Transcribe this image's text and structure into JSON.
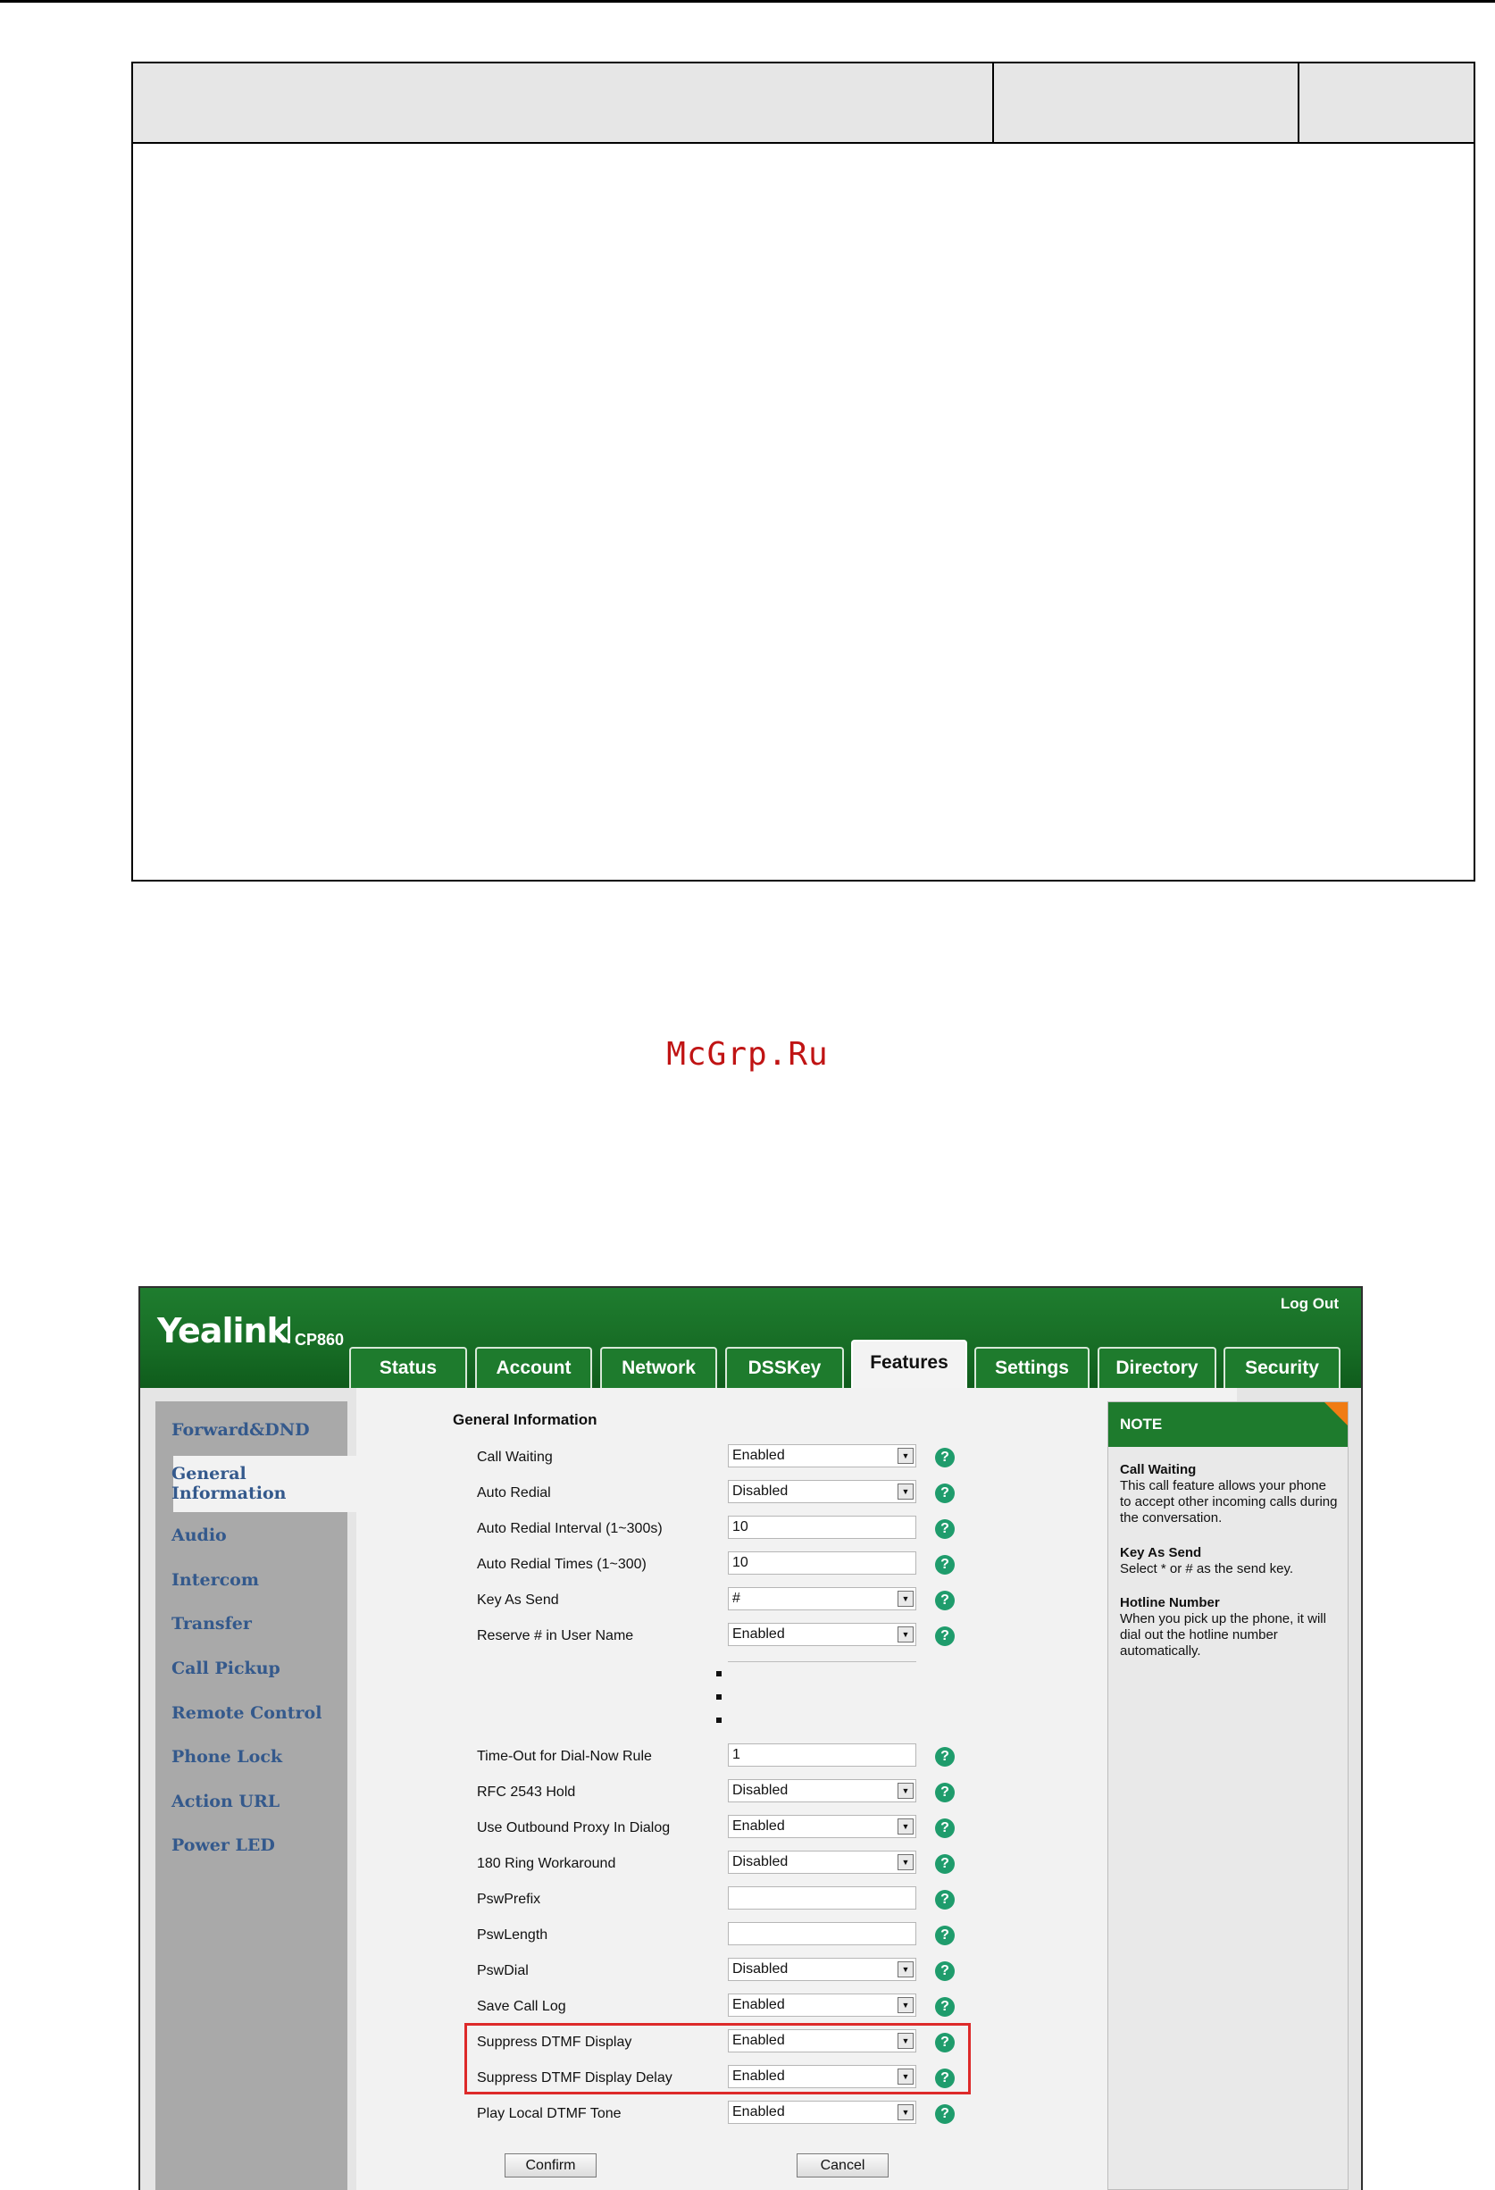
{
  "watermark": "McGrp.Ru",
  "brand": {
    "logo": "Yealink",
    "model": "CP860",
    "logout": "Log Out"
  },
  "tabs": [
    "Status",
    "Account",
    "Network",
    "DSSKey",
    "Features",
    "Settings",
    "Directory",
    "Security"
  ],
  "active_tab": "Features",
  "sidebar": {
    "items": [
      "Forward&DND",
      "General Information",
      "Audio",
      "Intercom",
      "Transfer",
      "Call Pickup",
      "Remote Control",
      "Phone Lock",
      "Action URL",
      "Power LED"
    ],
    "active": "General Information"
  },
  "form": {
    "title": "General Information",
    "rows": [
      {
        "label": "Call Waiting",
        "value": "Enabled",
        "type": "select"
      },
      {
        "label": "Auto Redial",
        "value": "Disabled",
        "type": "select"
      },
      {
        "label": "Auto Redial Interval (1~300s)",
        "value": "10",
        "type": "input"
      },
      {
        "label": "Auto Redial Times (1~300)",
        "value": "10",
        "type": "input"
      },
      {
        "label": "Key As Send",
        "value": "#",
        "type": "select"
      },
      {
        "label": "Reserve # in User Name",
        "value": "Enabled",
        "type": "select"
      },
      {
        "label": "Time-Out for Dial-Now Rule",
        "value": "1",
        "type": "input"
      },
      {
        "label": "RFC 2543 Hold",
        "value": "Disabled",
        "type": "select"
      },
      {
        "label": "Use Outbound Proxy In Dialog",
        "value": "Enabled",
        "type": "select"
      },
      {
        "label": "180 Ring Workaround",
        "value": "Disabled",
        "type": "select"
      },
      {
        "label": "PswPrefix",
        "value": "",
        "type": "input"
      },
      {
        "label": "PswLength",
        "value": "",
        "type": "input"
      },
      {
        "label": "PswDial",
        "value": "Disabled",
        "type": "select"
      },
      {
        "label": "Save Call Log",
        "value": "Enabled",
        "type": "select"
      },
      {
        "label": "Suppress DTMF Display",
        "value": "Enabled",
        "type": "select"
      },
      {
        "label": "Suppress DTMF Display Delay",
        "value": "Enabled",
        "type": "select"
      },
      {
        "label": "Play Local DTMF Tone",
        "value": "Enabled",
        "type": "select"
      }
    ],
    "confirm_label": "Confirm",
    "cancel_label": "Cancel"
  },
  "note": {
    "heading": "NOTE",
    "blocks": [
      {
        "title": "Call Waiting",
        "text": "This call feature allows your phone to accept other incoming calls during the conversation."
      },
      {
        "title": "Key As Send",
        "text": "Select * or # as the send key."
      },
      {
        "title": "Hotline Number",
        "text": "When you pick up the phone, it will dial out the hotline number automatically."
      }
    ]
  },
  "colors": {
    "brand_green": "#1e7b2d",
    "link_blue": "#34598c",
    "highlight_red": "#dd2a2a",
    "help_green": "#1f9c6c"
  }
}
